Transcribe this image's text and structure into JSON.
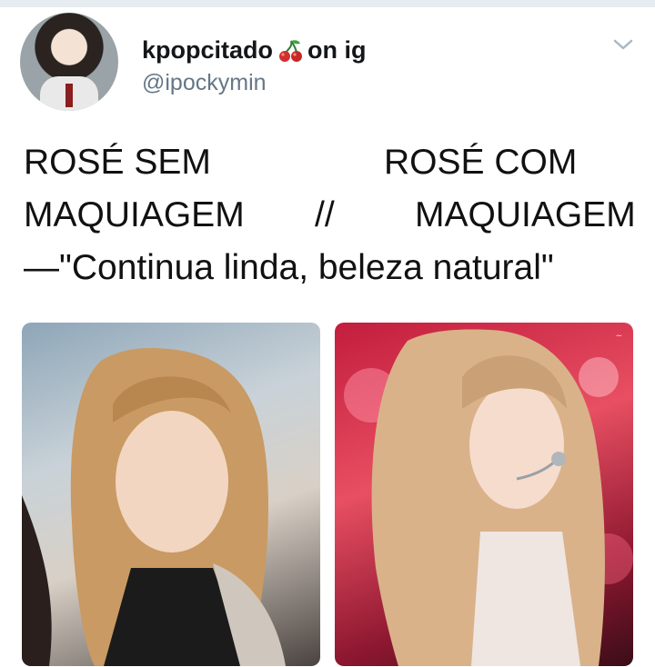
{
  "author": {
    "display_name": "kpopcitado",
    "display_suffix": "on ig",
    "handle": "@ipockymin",
    "avatar_icon": "user-avatar",
    "emoji_icon": "cherry-icon"
  },
  "menu_icon": "chevron-down-icon",
  "tweet": {
    "line1_left": "ROSÉ SEM",
    "line1_right": "ROSÉ COM",
    "line2_left": "MAQUIAGEM",
    "line2_sep": "//",
    "line2_right": "MAQUIAGEM",
    "line3": "—\"Continua linda, beleza natural\""
  },
  "media": {
    "left_photo": "photo-without-makeup",
    "right_photo": "photo-with-makeup"
  },
  "colors": {
    "text": "#14171a",
    "secondary": "#657786",
    "border": "#e6ecf0"
  }
}
